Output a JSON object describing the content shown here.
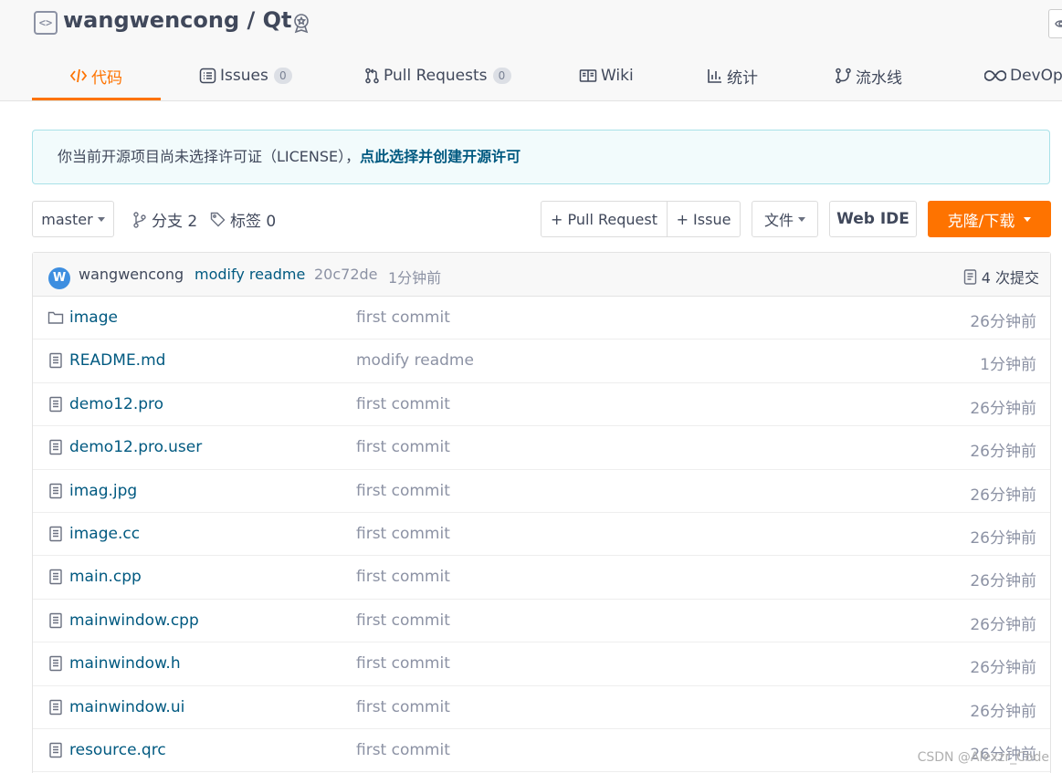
{
  "repo": {
    "title": "wangwencong / Qt"
  },
  "tabs": [
    {
      "label": "代码",
      "icon": "code-icon"
    },
    {
      "label": "Issues",
      "count": "0",
      "icon": "issues-icon"
    },
    {
      "label": "Pull Requests",
      "count": "0",
      "icon": "pull-request-icon"
    },
    {
      "label": "Wiki",
      "icon": "wiki-icon"
    },
    {
      "label": "统计",
      "icon": "stats-icon"
    },
    {
      "label": "流水线",
      "icon": "pipeline-icon"
    },
    {
      "label": "DevOp",
      "icon": "devops-icon"
    }
  ],
  "license": {
    "text": "你当前开源项目尚未选择许可证（LICENSE），",
    "link": "点此选择并创建开源许可"
  },
  "toolbar": {
    "branch": "master",
    "branches": "分支 2",
    "tags": "标签 0",
    "pull_request": "+ Pull Request",
    "issue": "+ Issue",
    "files": "文件",
    "web_ide": "Web IDE",
    "clone": "克隆/下载"
  },
  "commit": {
    "avatar_letter": "W",
    "user": "wangwencong",
    "message": "modify readme",
    "sha": "20c72de",
    "time": "1分钟前",
    "total": "4 次提交"
  },
  "files": [
    {
      "name": "image",
      "type": "folder",
      "message": "first commit",
      "time": "26分钟前"
    },
    {
      "name": "README.md",
      "type": "file",
      "message": "modify readme",
      "time": "1分钟前"
    },
    {
      "name": "demo12.pro",
      "type": "file",
      "message": "first commit",
      "time": "26分钟前"
    },
    {
      "name": "demo12.pro.user",
      "type": "file",
      "message": "first commit",
      "time": "26分钟前"
    },
    {
      "name": "imag.jpg",
      "type": "file",
      "message": "first commit",
      "time": "26分钟前"
    },
    {
      "name": "image.cc",
      "type": "file",
      "message": "first commit",
      "time": "26分钟前"
    },
    {
      "name": "main.cpp",
      "type": "file",
      "message": "first commit",
      "time": "26分钟前"
    },
    {
      "name": "mainwindow.cpp",
      "type": "file",
      "message": "first commit",
      "time": "26分钟前"
    },
    {
      "name": "mainwindow.h",
      "type": "file",
      "message": "first commit",
      "time": "26分钟前"
    },
    {
      "name": "mainwindow.ui",
      "type": "file",
      "message": "first commit",
      "time": "26分钟前"
    },
    {
      "name": "resource.qrc",
      "type": "file",
      "message": "first commit",
      "time": "26分钟前"
    }
  ],
  "watermark": "CSDN @Alexzr_Code",
  "colors": {
    "accent": "#fe7300",
    "link": "#005980",
    "muted": "#8c92a4"
  }
}
